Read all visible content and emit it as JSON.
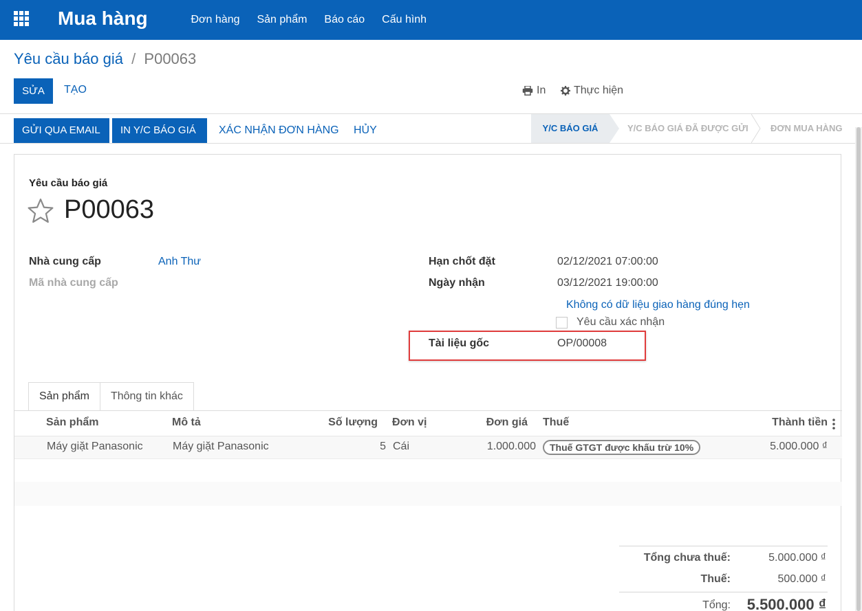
{
  "app": {
    "title": "Mua hàng",
    "menu": [
      "Đơn hàng",
      "Sản phẩm",
      "Báo cáo",
      "Cấu hình"
    ]
  },
  "breadcrumb": {
    "parent": "Yêu cầu báo giá",
    "separator": "/",
    "current": "P00063"
  },
  "controls": {
    "edit": "SỬA",
    "create": "TẠO",
    "print": "In",
    "action": "Thực hiện"
  },
  "statusbar": {
    "buttons": [
      "GỬI QUA EMAIL",
      "IN Y/C BÁO GIÁ"
    ],
    "links": [
      "XÁC NHẬN ĐƠN HÀNG",
      "HỦY"
    ],
    "stages": [
      "Y/C BÁO GIÁ",
      "Y/C BÁO GIÁ ĐÃ ĐƯỢC GỬI",
      "ĐƠN MUA HÀNG"
    ],
    "active_stage": "Y/C BÁO GIÁ"
  },
  "form": {
    "doc_type": "Yêu cầu báo giá",
    "name": "P00063",
    "vendor_label": "Nhà cung cấp",
    "vendor": "Anh Thư",
    "vendor_ref_label": "Mã nhà cung cấp",
    "deadline_label": "Hạn chốt đặt",
    "deadline": "02/12/2021 07:00:00",
    "receipt_label": "Ngày nhận",
    "receipt": "03/12/2021 19:00:00",
    "on_time_link": "Không có dữ liệu giao hàng đúng hẹn",
    "ask_confirm_label": "Yêu cầu xác nhận",
    "ask_confirm_checked": false,
    "origin_label": "Tài liệu gốc",
    "origin": "OP/00008"
  },
  "tabs": [
    "Sản phẩm",
    "Thông tin khác"
  ],
  "table": {
    "headers": [
      "Sản phẩm",
      "Mô tả",
      "Số lượng",
      "Đơn vị",
      "Đơn giá",
      "Thuế",
      "Thành tiền"
    ],
    "rows": [
      {
        "product": "Máy giặt Panasonic",
        "description": "Máy giặt Panasonic",
        "quantity": "5",
        "uom": "Cái",
        "price": "1.000.000",
        "tax": "Thuế GTGT được khấu trừ 10%",
        "subtotal": "5.000.000 ₫"
      }
    ]
  },
  "totals": {
    "untaxed_label": "Tổng chưa thuế:",
    "untaxed": "5.000.000 ₫",
    "tax_label": "Thuế:",
    "tax": "500.000 ₫",
    "total_label": "Tổng:",
    "total": "5.500.000 ₫"
  },
  "colors": {
    "brand": "#0a62b8",
    "highlight": "#e03c3c"
  },
  "icons": [
    "apps-icon",
    "printer-icon",
    "gear-icon",
    "star-icon",
    "kebab-icon"
  ]
}
